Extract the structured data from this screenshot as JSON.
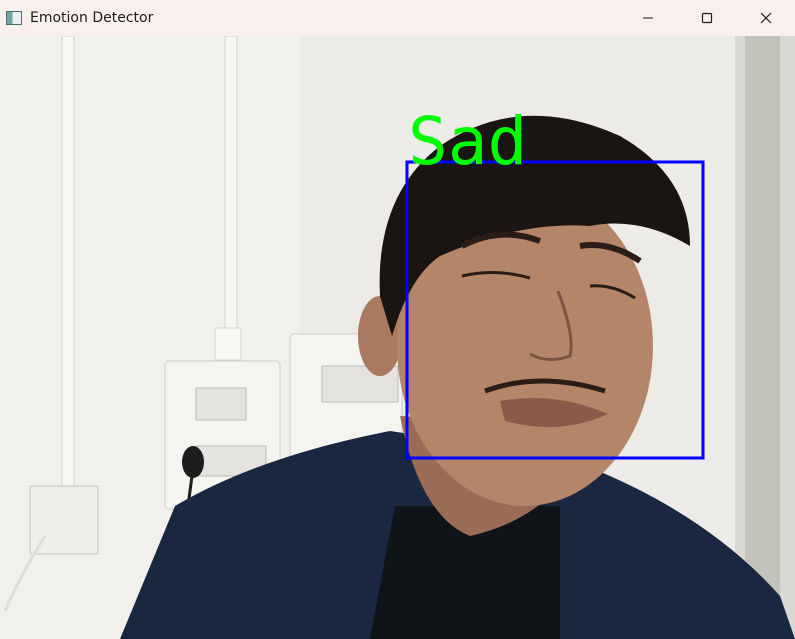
{
  "window": {
    "title": "Emotion Detector",
    "app_icon": "opencv-window-icon",
    "controls": [
      "minimize-icon",
      "maximize-icon",
      "close-icon"
    ]
  },
  "detection": {
    "label": "Sad",
    "label_color": "#00ff00",
    "box_color": "#0000ff"
  },
  "colors": {
    "titlebar_bg": "#f9f0ee",
    "wall": "#ecebe7",
    "shirt": "#1a2740"
  }
}
